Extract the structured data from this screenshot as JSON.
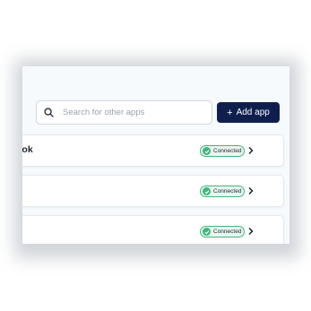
{
  "search": {
    "placeholder": "Search for other apps",
    "icon": "search-icon"
  },
  "toolbar": {
    "add_plus": "+",
    "add_label": "Add app"
  },
  "apps": [
    {
      "name": "ook",
      "status": "Connected"
    },
    {
      "name": "",
      "status": "Connected"
    },
    {
      "name": "",
      "status": "Connected"
    }
  ],
  "colors": {
    "primary_button": "#0f1f4d",
    "status_green": "#3fb67a",
    "status_bg": "#e8f7ef",
    "panel_bg": "#f6fafd"
  }
}
